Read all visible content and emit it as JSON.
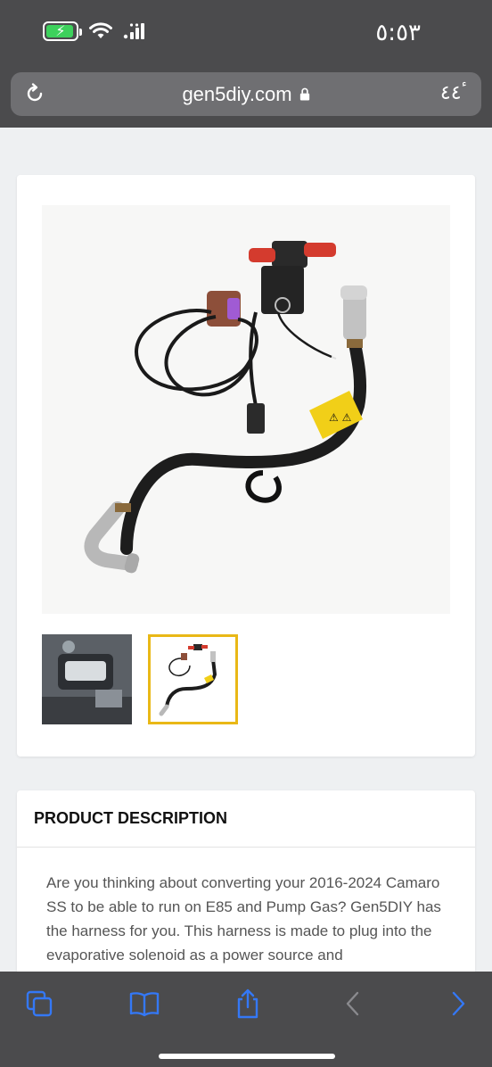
{
  "status_bar": {
    "time": "٥:٥٣",
    "battery_icon": "charging-battery-icon",
    "wifi_icon": "wifi-icon",
    "signal_icon": "cellular-signal-icon"
  },
  "browser": {
    "domain": "gen5diy.com",
    "reader_label": "ٴ٤٤"
  },
  "gallery": {
    "main_image_alt": "harness",
    "thumbnails": [
      {
        "name": "engine-bay"
      },
      {
        "name": "harness",
        "selected": true
      }
    ],
    "selected_border_color": "#e9b816"
  },
  "description": {
    "heading": "PRODUCT DESCRIPTION",
    "text": "Are you thinking about converting your 2016-2024 Camaro SS to be able to run on E85 and Pump Gas? Gen5DIY has the harness for you.  This harness is made to plug into the evaporative solenoid as a power source and"
  },
  "toolbar": {
    "accent_color": "#3478f6",
    "disabled_color": "#8a8a8e"
  }
}
